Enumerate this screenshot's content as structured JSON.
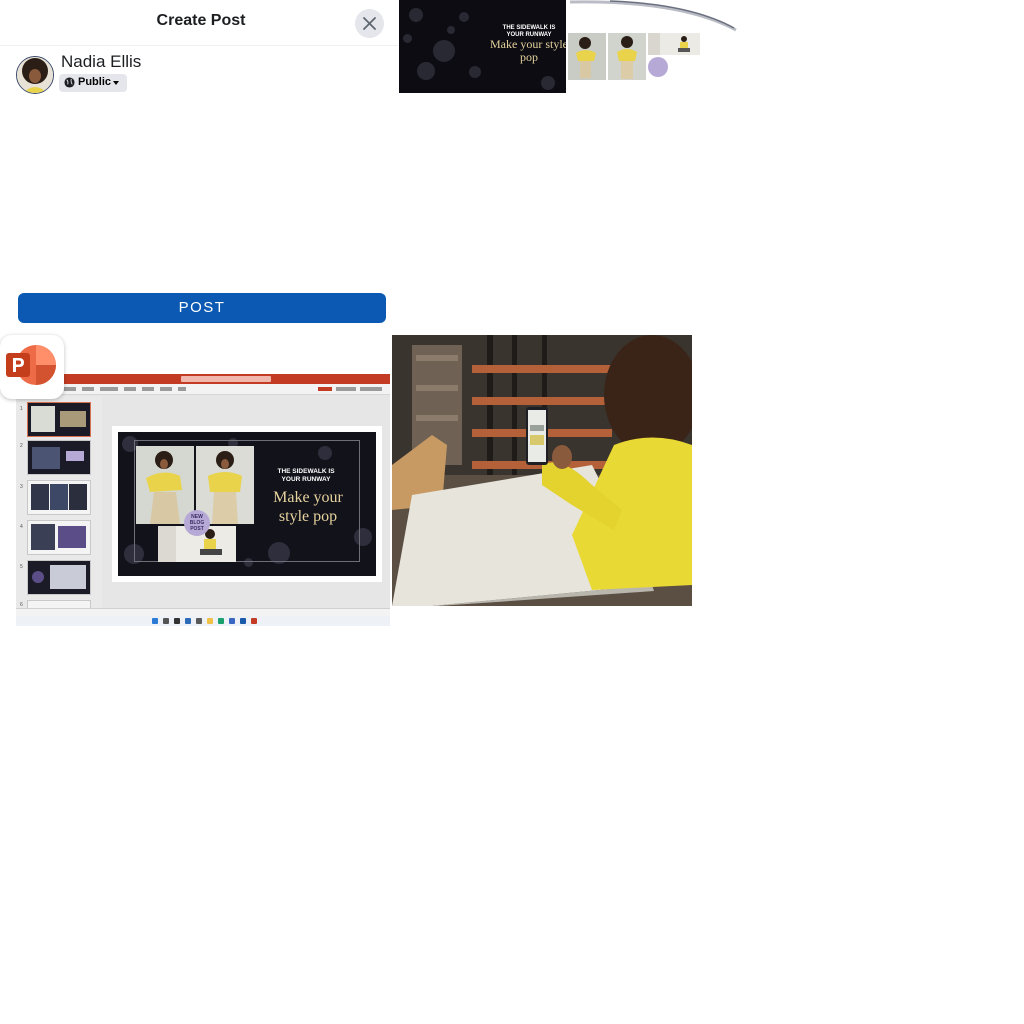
{
  "dialog": {
    "title": "Create Post",
    "user_name": "Nadia Ellis",
    "audience_label": "Public",
    "composer_value": "",
    "post_label": "POST",
    "icons": {
      "close": "close-icon",
      "audience": "globe-icon",
      "dropdown": "caret-down-icon"
    }
  },
  "slide": {
    "kicker": "THE SIDEWALK IS YOUR RUNWAY",
    "title": "Make your style pop",
    "badge": "NEW BLOG POST"
  },
  "powerpoint": {
    "app_icon": "powerpoint-icon",
    "thumbnail_numbers": [
      "1",
      "2",
      "3",
      "4",
      "5",
      "6"
    ]
  },
  "colors": {
    "post_button": "#0b59b3",
    "powerpoint_accent": "#c23b22",
    "slide_background": "#12121b",
    "slide_title": "#e5d29d",
    "badge": "#b7a9d6"
  }
}
